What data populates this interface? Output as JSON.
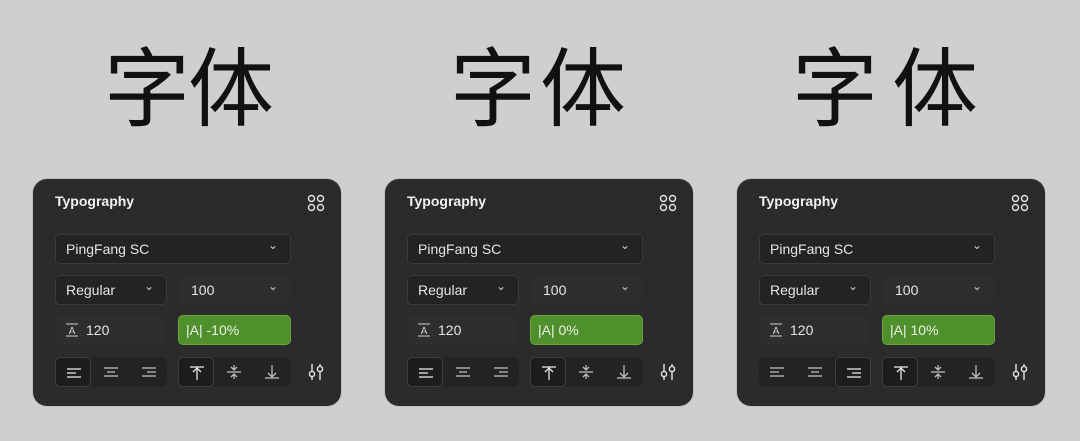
{
  "panels": [
    {
      "glyphs": "字体",
      "title": "Typography",
      "font_family": "PingFang SC",
      "font_weight": "Regular",
      "font_size": "100",
      "line_height": "120",
      "letter_spacing": "|A| -10%"
    },
    {
      "glyphs": "字体",
      "title": "Typography",
      "font_family": "PingFang SC",
      "font_weight": "Regular",
      "font_size": "100",
      "line_height": "120",
      "letter_spacing": "|A| 0%"
    },
    {
      "glyphs": "字体",
      "title": "Typography",
      "font_family": "PingFang SC",
      "font_weight": "Regular",
      "font_size": "100",
      "line_height": "120",
      "letter_spacing": "|A| 10%"
    }
  ],
  "icons": {
    "chevron": "chevron-down-icon",
    "grid": "grid-dots-icon",
    "line_height": "line-height-icon",
    "align_left": "align-left-icon",
    "align_center": "align-center-icon",
    "align_right": "align-right-icon",
    "valign_top": "align-top-icon",
    "valign_middle": "align-middle-icon",
    "valign_bottom": "align-bottom-icon",
    "settings": "sliders-icon"
  },
  "colors": {
    "background": "#cfcfcf",
    "panel": "#2b2b2c",
    "highlight": "#4f8f2c"
  }
}
